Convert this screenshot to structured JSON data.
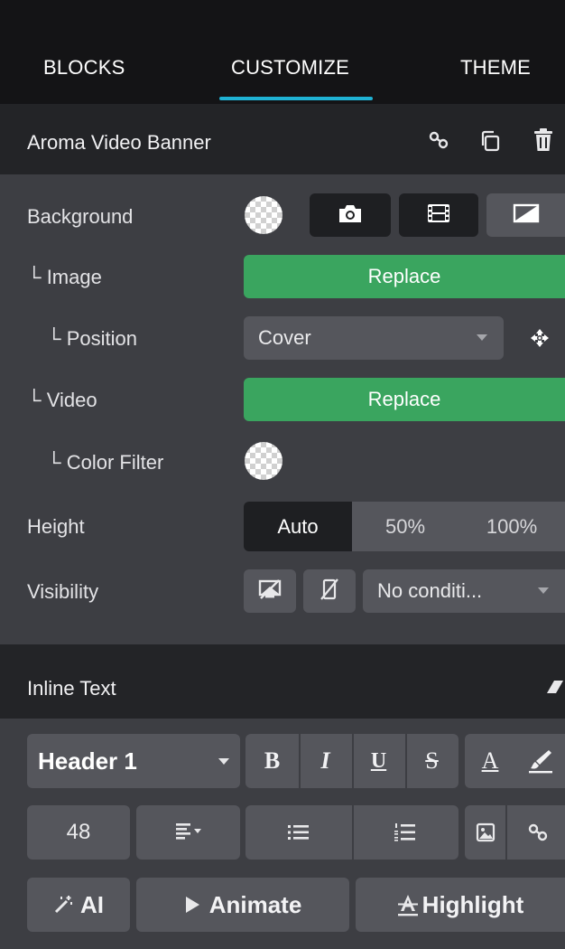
{
  "tabs": [
    {
      "label": "BLOCKS"
    },
    {
      "label": "CUSTOMIZE",
      "active": true
    },
    {
      "label": "THEME"
    }
  ],
  "block": {
    "title": "Aroma Video Banner",
    "header_icons": [
      "link-icon",
      "duplicate-icon",
      "trash-icon"
    ]
  },
  "settings": {
    "background_label": "Background",
    "background_type_icons": [
      "camera-icon",
      "film-icon",
      "gradient-icon"
    ],
    "image_label": "└ Image",
    "image_button": "Replace",
    "position_label": "└ Position",
    "position_value": "Cover",
    "position_icon": "focal-point-icon",
    "video_label": "└ Video",
    "video_button": "Replace",
    "color_filter_label": "└ Color Filter",
    "height_label": "Height",
    "height_options": [
      "Auto",
      "50%",
      "100%"
    ],
    "height_selected": "Auto",
    "visibility_label": "Visibility",
    "visibility_icons": [
      "hide-desktop-icon",
      "hide-mobile-icon"
    ],
    "visibility_value": "No conditi..."
  },
  "inline_text": {
    "title": "Inline Text",
    "header_icon": "eraser-icon",
    "style_value": "Header 1",
    "format_icons": [
      "bold-icon",
      "italic-icon",
      "underline-icon",
      "strikethrough-icon",
      "text-color-icon",
      "highlight-color-icon"
    ],
    "bold": "B",
    "italic": "I",
    "underline": "U",
    "strike": "S",
    "text_color": "A",
    "font_size": "48",
    "ai_label": "AI",
    "animate_label": "Animate",
    "highlight_label": "Highlight"
  },
  "colors": {
    "accent": "#1fb2d4",
    "green": "#3aa55f",
    "dark_panel": "#232427",
    "body_panel": "#3d3e43",
    "control": "#55565c"
  }
}
